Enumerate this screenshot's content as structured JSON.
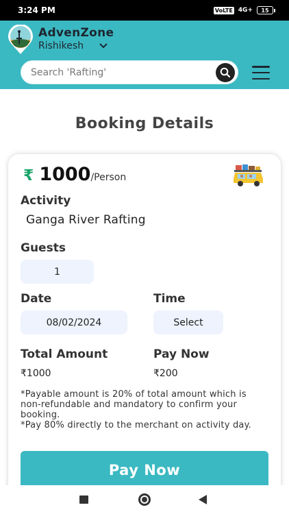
{
  "status_bar": {
    "time": "3:24 PM",
    "network_chip": "VoLTE",
    "signal": "4G+",
    "battery": "15"
  },
  "header": {
    "app_name": "AdvenZone",
    "location": "Rishikesh",
    "search_placeholder": "Search 'Rafting'",
    "brand_color": "#3bb9c2"
  },
  "page": {
    "title": "Booking Details"
  },
  "booking": {
    "currency_symbol": "₹",
    "price": "1000",
    "price_unit": "/Person",
    "activity_label": "Activity",
    "activity_name": "Ganga River Rafting",
    "guests_label": "Guests",
    "guests_value": "1",
    "date_label": "Date",
    "date_value": "08/02/2024",
    "time_label": "Time",
    "time_value": "Select",
    "total_label": "Total Amount",
    "total_value": "₹1000",
    "pay_now_label": "Pay Now",
    "pay_now_value": "₹200",
    "note_line1": "*Payable amount is 20% of total amount which is non-refundable and mandatory to confirm your booking.",
    "note_line2": "*Pay 80% directly to the merchant on activity day.",
    "pay_button": "Pay Now"
  },
  "icons": {
    "logo": "adventure-logo-icon",
    "location_chevron": "chevron-down-icon",
    "search": "search-icon",
    "menu": "hamburger-menu-icon",
    "car": "car-with-luggage-illustration",
    "nav_recent": "square-icon",
    "nav_home": "circle-icon",
    "nav_back": "back-triangle-icon"
  }
}
